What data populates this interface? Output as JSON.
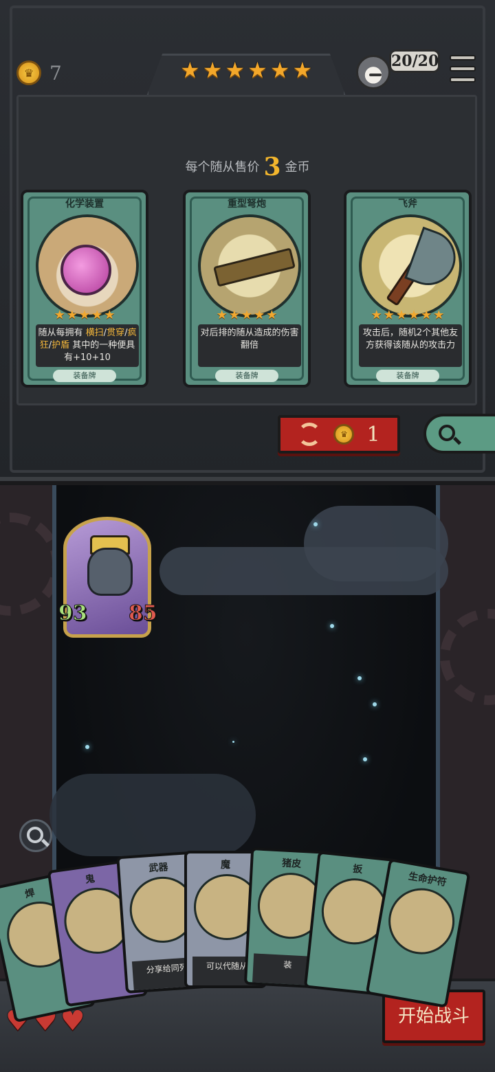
{
  "shop": {
    "gold": "7",
    "rating_stars": 6,
    "population": "20/20",
    "price_prefix": "每个随从售价",
    "price_value": "3",
    "price_suffix": "金币",
    "refresh_cost": "1",
    "cards": [
      {
        "title": "化学装置",
        "stars": 5,
        "desc_parts": [
          {
            "t": "随从每拥有 ",
            "hl": false
          },
          {
            "t": "横扫",
            "hl": true
          },
          {
            "t": "/",
            "hl": false
          },
          {
            "t": "贯穿",
            "hl": true
          },
          {
            "t": "/",
            "hl": false
          },
          {
            "t": "疯狂",
            "hl": true
          },
          {
            "t": "/",
            "hl": false
          },
          {
            "t": "护盾",
            "hl": true
          },
          {
            "t": " 其中的一种便具有+10+10",
            "hl": false
          }
        ],
        "tag": "装备牌"
      },
      {
        "title": "重型弩炮",
        "stars": 5,
        "desc_parts": [
          {
            "t": "对后排的随从造成的伤害翻倍",
            "hl": false
          }
        ],
        "tag": "装备牌"
      },
      {
        "title": "飞斧",
        "stars": 6,
        "desc_parts": [
          {
            "t": "攻击后，随机2个其他友方获得该随从的攻击力",
            "hl": false
          }
        ],
        "tag": "装备牌"
      }
    ]
  },
  "board": {
    "minion": {
      "attack": "93",
      "health": "85"
    }
  },
  "hand": [
    {
      "title": "焊",
      "color": "green",
      "desc": ""
    },
    {
      "title": "鬼",
      "color": "purple",
      "desc": ""
    },
    {
      "title": "武器",
      "color": "grey",
      "desc": "分享给同列"
    },
    {
      "title": "魔",
      "color": "grey",
      "desc": "可以代随从"
    },
    {
      "title": "猪皮",
      "color": "green",
      "desc": "装"
    },
    {
      "title": "扳",
      "color": "green",
      "desc": ""
    },
    {
      "title": "生命护符",
      "color": "green",
      "desc": ""
    }
  ],
  "lives": 3,
  "start_button": "开始战斗",
  "colors": {
    "accent_red": "#b3231f",
    "gold": "#f3b62d",
    "card_green": "#5a8f80"
  }
}
